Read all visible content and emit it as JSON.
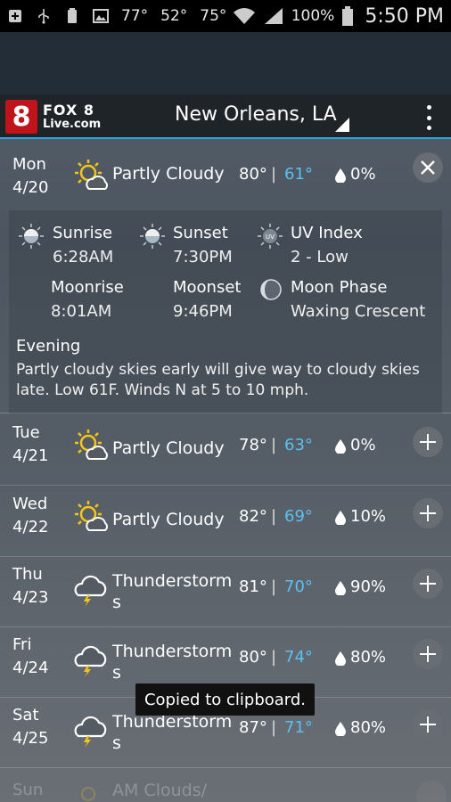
{
  "status": {
    "temps": [
      "77°",
      "52°",
      "75°"
    ],
    "battery": "100%",
    "time": "5:50 PM"
  },
  "app": {
    "logo_text1": "FOX 8",
    "logo_text2": "Live.com",
    "city": "New Orleans, LA"
  },
  "colors": {
    "accent": "#2ea6e0",
    "low_temp": "#5cc0f0",
    "logo_red": "#c0141b"
  },
  "forecast_today": {
    "day": "Mon",
    "date": "4/20",
    "icon": "partly-cloudy-icon",
    "condition": "Partly Cloudy",
    "high": "80°",
    "low": "61°",
    "precip": "0%",
    "astro": {
      "sunrise_label": "Sunrise",
      "sunrise": "6:28AM",
      "sunset_label": "Sunset",
      "sunset": "7:30PM",
      "uv_label": "UV Index",
      "uv": "2 - Low",
      "moonrise_label": "Moonrise",
      "moonrise": "8:01AM",
      "moonset_label": "Moonset",
      "moonset": "9:46PM",
      "moonphase_label": "Moon Phase",
      "moonphase": "Waxing Crescent"
    },
    "evening_title": "Evening",
    "evening_text": "Partly cloudy skies early will give way to cloudy skies late. Low 61F. Winds N at 5 to 10 mph."
  },
  "forecast": [
    {
      "day": "Tue",
      "date": "4/21",
      "icon": "partly-cloudy-icon",
      "condition": "Partly Cloudy",
      "high": "78°",
      "low": "63°",
      "precip": "0%"
    },
    {
      "day": "Wed",
      "date": "4/22",
      "icon": "partly-cloudy-icon",
      "condition": "Partly Cloudy",
      "high": "82°",
      "low": "69°",
      "precip": "10%"
    },
    {
      "day": "Thu",
      "date": "4/23",
      "icon": "thunderstorm-icon",
      "condition_l1": "Thunderstorm",
      "condition_l2": "s",
      "high": "81°",
      "low": "70°",
      "precip": "90%"
    },
    {
      "day": "Fri",
      "date": "4/24",
      "icon": "thunderstorm-icon",
      "condition_l1": "Thunderstorm",
      "condition_l2": "s",
      "high": "80°",
      "low": "74°",
      "precip": "80%"
    },
    {
      "day": "Sat",
      "date": "4/25",
      "icon": "thunderstorm-icon",
      "condition_l1": "Thunderstorm",
      "condition_l2": "s",
      "high": "87°",
      "low": "71°",
      "precip": "80%"
    }
  ],
  "partial_row": {
    "day": "Sun",
    "condition": "AM Clouds/"
  },
  "toast": "Copied to clipboard."
}
